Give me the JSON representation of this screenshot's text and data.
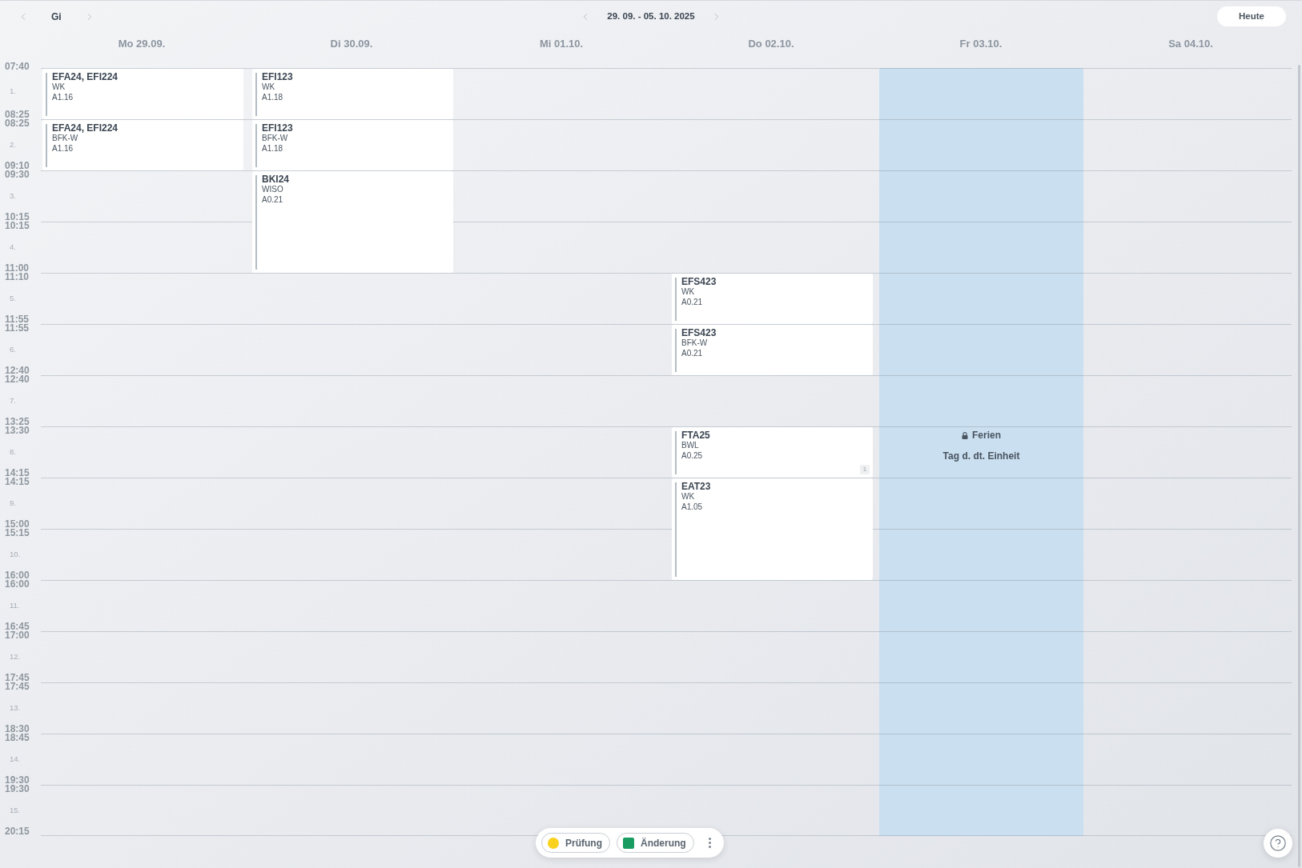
{
  "toolbar": {
    "teacher": "Gi",
    "week_range": "29. 09. - 05. 10. 2025",
    "today_button": "Heute"
  },
  "days": [
    {
      "label": "Mo 29.09.",
      "slots": [
        {
          "kind": "lesson",
          "classes": "EFA24, EFI224",
          "subject": "WK",
          "room": "A1.16",
          "double": false
        },
        {
          "kind": "lesson",
          "classes": "EFA24, EFI224",
          "subject": "BFK-W",
          "room": "A1.16",
          "double": false
        }
      ]
    },
    {
      "label": "Di 30.09.",
      "slots": [
        {
          "kind": "lesson",
          "classes": "EFI123",
          "subject": "WK",
          "room": "A1.18",
          "double": false
        },
        {
          "kind": "lesson",
          "classes": "EFI123",
          "subject": "BFK-W",
          "room": "A1.18",
          "double": false
        },
        {
          "kind": "lesson",
          "classes": "BKI24",
          "subject": "WISO",
          "room": "A0.21",
          "double": true
        }
      ]
    },
    {
      "label": "Mi 01.10."
    },
    {
      "label": "Do 02.10.",
      "slots": [
        {
          "kind": "free"
        },
        {
          "kind": "free"
        },
        {
          "kind": "free"
        },
        {
          "kind": "free"
        },
        {
          "kind": "lesson",
          "classes": "EFS423",
          "subject": "WK",
          "room": "A0.21",
          "double": false
        },
        {
          "kind": "lesson",
          "classes": "EFS423",
          "subject": "BFK-W",
          "room": "A0.21",
          "double": false
        },
        {
          "kind": "free"
        },
        {
          "kind": "lesson",
          "classes": "FTA25",
          "subject": "BWL",
          "room": "A0.25",
          "double": false,
          "badge": "1"
        },
        {
          "kind": "lesson",
          "classes": "EAT23",
          "subject": "WK",
          "room": "A1.05",
          "double": true
        }
      ]
    },
    {
      "label": "Fr 03.10.",
      "holiday": {
        "title": "Ferien",
        "name": "Tag d. dt. Einheit"
      }
    },
    {
      "label": "Sa 04.10."
    }
  ],
  "periods": [
    {
      "number": "1.",
      "start": "07:40",
      "end": "08:25"
    },
    {
      "number": "2.",
      "start": "08:25",
      "end": "09:10"
    },
    {
      "number": "3.",
      "start": "09:30",
      "end": "10:15"
    },
    {
      "number": "4.",
      "start": "10:15",
      "end": "11:00"
    },
    {
      "number": "5.",
      "start": "11:10",
      "end": "11:55"
    },
    {
      "number": "6.",
      "start": "11:55",
      "end": "12:40"
    },
    {
      "number": "7.",
      "start": "12:40",
      "end": "13:25"
    },
    {
      "number": "8.",
      "start": "13:30",
      "end": "14:15"
    },
    {
      "number": "9.",
      "start": "14:15",
      "end": "15:00"
    },
    {
      "number": "10.",
      "start": "15:15",
      "end": "16:00"
    },
    {
      "number": "11.",
      "start": "16:00",
      "end": "16:45"
    },
    {
      "number": "12.",
      "start": "17:00",
      "end": "17:45"
    },
    {
      "number": "13.",
      "start": "17:45",
      "end": "18:30"
    },
    {
      "number": "14.",
      "start": "18:45",
      "end": "19:30"
    },
    {
      "number": "15.",
      "start": "19:30",
      "end": "20:15"
    }
  ],
  "legend": [
    {
      "label": "Prüfung",
      "kind": "dot",
      "color": "#f8d21c"
    },
    {
      "label": "Änderung",
      "kind": "square",
      "color": "#189c5f"
    }
  ]
}
